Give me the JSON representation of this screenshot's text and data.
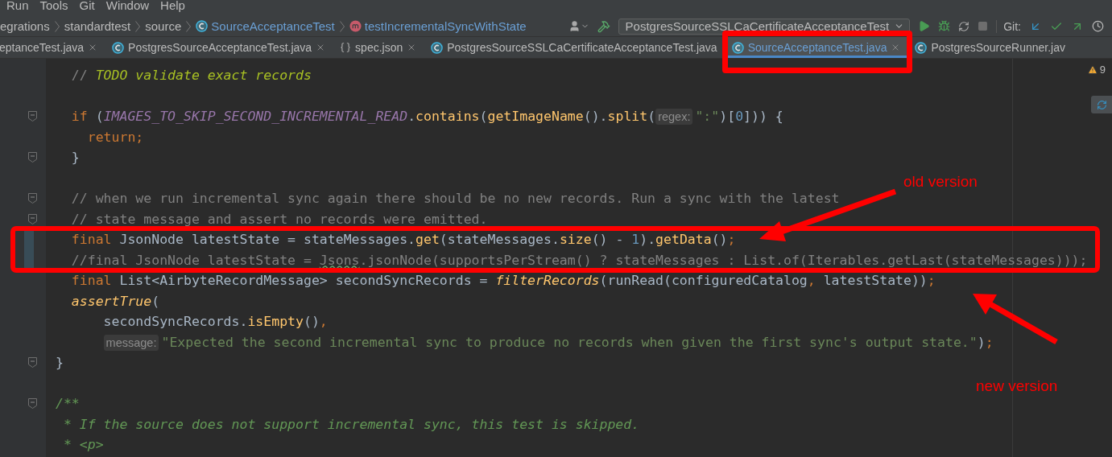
{
  "menu": [
    "Run",
    "Tools",
    "Git",
    "Window",
    "Help"
  ],
  "breadcrumbs": [
    {
      "label": "egrations",
      "kind": "folder"
    },
    {
      "label": "standardtest",
      "kind": "folder"
    },
    {
      "label": "source",
      "kind": "folder"
    },
    {
      "label": "SourceAcceptanceTest",
      "kind": "class"
    },
    {
      "label": "testIncrementalSyncWithState",
      "kind": "method"
    }
  ],
  "run_config": "PostgresSourceSSLCaCertificateAcceptanceTest",
  "git_label": "Git:",
  "tabs": [
    {
      "label": "eptanceTest.java",
      "kind": "none",
      "selected": false,
      "closable": true
    },
    {
      "label": "PostgresSourceAcceptanceTest.java",
      "kind": "class",
      "selected": false,
      "closable": true
    },
    {
      "label": "spec.json",
      "kind": "json",
      "selected": false,
      "closable": true
    },
    {
      "label": "PostgresSourceSSLCaCertificateAcceptanceTest.java",
      "kind": "class",
      "selected": false,
      "closable": false
    },
    {
      "label": "SourceAcceptanceTest.java",
      "kind": "class",
      "selected": true,
      "closable": true
    },
    {
      "label": "PostgresSourceRunner.jav",
      "kind": "class",
      "selected": false,
      "closable": false
    }
  ],
  "inspections": {
    "warnings": "9"
  },
  "editor": {
    "lines": [
      {
        "kind": "code",
        "fold": false,
        "changed": false,
        "tokens": [
          {
            "kind": "comment",
            "text": "  // "
          },
          {
            "kind": "todo",
            "text": "TODO validate exact records"
          }
        ]
      },
      {
        "kind": "blank"
      },
      {
        "kind": "code",
        "fold": true,
        "changed": false,
        "tokens": [
          {
            "kind": "keyword",
            "text": "  if"
          },
          {
            "kind": "plain",
            "text": " ("
          },
          {
            "kind": "constant",
            "text": "IMAGES_TO_SKIP_SECOND_INCREMENTAL_READ"
          },
          {
            "kind": "plain",
            "text": "."
          },
          {
            "kind": "method",
            "text": "contains"
          },
          {
            "kind": "plain",
            "text": "("
          },
          {
            "kind": "method",
            "text": "getImageName"
          },
          {
            "kind": "plain",
            "text": "()."
          },
          {
            "kind": "method",
            "text": "split"
          },
          {
            "kind": "plain",
            "text": "("
          },
          {
            "kind": "hint",
            "text": "regex:"
          },
          {
            "kind": "string",
            "text": "\":\""
          },
          {
            "kind": "plain",
            "text": ")["
          },
          {
            "kind": "number",
            "text": "0"
          },
          {
            "kind": "plain",
            "text": "])) {"
          }
        ]
      },
      {
        "kind": "code",
        "fold": false,
        "changed": false,
        "tokens": [
          {
            "kind": "keyword",
            "text": "    return;"
          }
        ]
      },
      {
        "kind": "code",
        "fold": true,
        "changed": false,
        "tokens": [
          {
            "kind": "plain",
            "text": "  }"
          }
        ]
      },
      {
        "kind": "blank"
      },
      {
        "kind": "code",
        "fold": true,
        "changed": false,
        "tokens": [
          {
            "kind": "comment",
            "text": "  // when we run incremental sync again there should be no new records. Run a sync with the latest"
          }
        ]
      },
      {
        "kind": "code",
        "fold": true,
        "changed": false,
        "tokens": [
          {
            "kind": "comment",
            "text": "  // state message and assert no records were emitted."
          }
        ]
      },
      {
        "kind": "code",
        "fold": false,
        "changed": true,
        "tokens": [
          {
            "kind": "keyword",
            "text": "  final"
          },
          {
            "kind": "plain",
            "text": " JsonNode latestState = stateMessages."
          },
          {
            "kind": "method",
            "text": "get"
          },
          {
            "kind": "plain",
            "text": "(stateMessages."
          },
          {
            "kind": "method",
            "text": "size"
          },
          {
            "kind": "plain",
            "text": "() - "
          },
          {
            "kind": "number",
            "text": "1"
          },
          {
            "kind": "plain",
            "text": ")."
          },
          {
            "kind": "method",
            "text": "getData"
          },
          {
            "kind": "plain",
            "text": "()"
          },
          {
            "kind": "keyword",
            "text": ";"
          }
        ]
      },
      {
        "kind": "code",
        "fold": false,
        "changed": true,
        "tokens": [
          {
            "kind": "comment",
            "text": "  //final JsonNode latestState = "
          },
          {
            "kind": "typo",
            "text": "Jsons"
          },
          {
            "kind": "comment",
            "text": ".jsonNode(supportsPerStream() ? stateMessages : List.of(Iterables.getLast(stateMessages)));"
          }
        ]
      },
      {
        "kind": "code",
        "fold": false,
        "changed": false,
        "tokens": [
          {
            "kind": "keyword",
            "text": "  final"
          },
          {
            "kind": "plain",
            "text": " List<AirbyteRecordMessage> secondSyncRecords = "
          },
          {
            "kind": "italic_method",
            "text": "filterRecords"
          },
          {
            "kind": "plain",
            "text": "(runRead(configuredCatalog"
          },
          {
            "kind": "keyword",
            "text": ","
          },
          {
            "kind": "plain",
            "text": " latestState))"
          },
          {
            "kind": "keyword",
            "text": ";"
          }
        ]
      },
      {
        "kind": "code",
        "fold": false,
        "changed": false,
        "tokens": [
          {
            "kind": "italic_method",
            "text": "  assertTrue"
          },
          {
            "kind": "plain",
            "text": "("
          }
        ]
      },
      {
        "kind": "code",
        "fold": false,
        "changed": false,
        "tokens": [
          {
            "kind": "plain",
            "text": "      secondSyncRecords."
          },
          {
            "kind": "method",
            "text": "isEmpty"
          },
          {
            "kind": "plain",
            "text": "()"
          },
          {
            "kind": "keyword",
            "text": ","
          }
        ]
      },
      {
        "kind": "continuation",
        "fold": false,
        "changed": false,
        "tokens": [
          {
            "kind": "hint",
            "text": "message:"
          },
          {
            "kind": "string",
            "text": "\"Expected the second incremental sync to produce no records when given the first sync's output state.\""
          },
          {
            "kind": "plain",
            "text": ")"
          },
          {
            "kind": "keyword",
            "text": ";"
          }
        ]
      },
      {
        "kind": "code",
        "fold": true,
        "changed": false,
        "tokens": [
          {
            "kind": "plain",
            "text": "}"
          }
        ]
      },
      {
        "kind": "blank"
      },
      {
        "kind": "code",
        "fold": true,
        "changed": false,
        "tokens": [
          {
            "kind": "doc",
            "text": "/**"
          }
        ]
      },
      {
        "kind": "code",
        "fold": false,
        "changed": false,
        "tokens": [
          {
            "kind": "doc",
            "text": " * If the source does not support incremental sync, this test is skipped."
          }
        ]
      },
      {
        "kind": "code",
        "fold": false,
        "changed": false,
        "tokens": [
          {
            "kind": "doc",
            "text": " * <p>"
          }
        ]
      }
    ]
  },
  "annotations": [
    "old version",
    "new version"
  ]
}
